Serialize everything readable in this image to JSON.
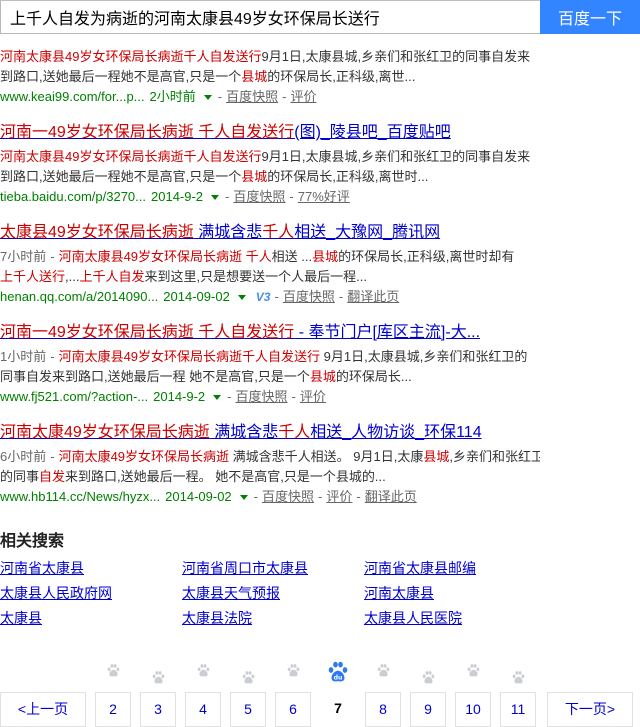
{
  "search": {
    "query": "上千人自发为病逝的河南太康县49岁女环保局长送行",
    "button_label": "百度一下"
  },
  "separator": "-",
  "results": [
    {
      "lines": [
        [
          {
            "text": "河南太康县49岁女环保局长病逝千人自发送行",
            "em": true
          },
          {
            "text": "9月1日,太康县城,乡亲们和张红卫的同事自发来",
            "em": false
          }
        ],
        [
          {
            "text": "到路口,送她最后一程她不是高官,只是一个",
            "em": false
          },
          {
            "text": "县城",
            "em": true
          },
          {
            "text": "的环保局长,正科级,离世...",
            "em": false
          }
        ]
      ],
      "url": "www.keai99.com/for...p...",
      "date": "2小时前",
      "links": [
        "百度快照",
        "评价"
      ]
    },
    {
      "title": [
        {
          "text": "河南一49岁女环保局长病逝 千人自发送行",
          "em": true
        },
        {
          "text": "(图)_陵县吧_百度贴吧",
          "em": false
        }
      ],
      "lines": [
        [
          {
            "text": "河南太康县49岁女环保局长病逝千人自发送行",
            "em": true
          },
          {
            "text": "9月1日,太康县城,乡亲们和张红卫的同事自发来",
            "em": false
          }
        ],
        [
          {
            "text": "到路口,送她最后一程她不是高官,只是一个",
            "em": false
          },
          {
            "text": "县城",
            "em": true
          },
          {
            "text": "的环保局长,正科级,离世时...",
            "em": false
          }
        ]
      ],
      "url": "tieba.baidu.com/p/3270...",
      "date": "2014-9-2",
      "links": [
        "百度快照",
        "77%好评"
      ]
    },
    {
      "title": [
        {
          "text": "太康县49岁女环保局长病逝",
          "em": true
        },
        {
          "text": " 满城含悲",
          "em": false
        },
        {
          "text": "千人",
          "em": true
        },
        {
          "text": "相送_大豫网_腾讯网",
          "em": false
        }
      ],
      "time": "7小时前",
      "lines": [
        [
          {
            "text": "河南太康县49岁女环保局长病逝 ",
            "em": true
          },
          {
            "text": "千人",
            "em": true
          },
          {
            "text": "相送 ...",
            "em": false
          },
          {
            "text": "县城",
            "em": true
          },
          {
            "text": "的环保局长,正科级,离世时却有",
            "em": false
          }
        ],
        [
          {
            "text": "上千人送行",
            "em": true
          },
          {
            "text": ",...",
            "em": false
          },
          {
            "text": "上千人自发",
            "em": true
          },
          {
            "text": "来到这里,只是想要送一个人最后一程...",
            "em": false
          }
        ]
      ],
      "url": "henan.qq.com/a/2014090...",
      "date": "2014-09-02",
      "badge": "V3",
      "links": [
        "百度快照",
        "翻译此页"
      ]
    },
    {
      "title": [
        {
          "text": "河南一49岁女环保局长病逝 千人自发送行",
          "em": true
        },
        {
          "text": " - 奉节门户[库区主流]-大...",
          "em": false
        }
      ],
      "time": "1小时前",
      "lines": [
        [
          {
            "text": "河南太康县49岁女环保局长病逝千人自发送行",
            "em": true
          },
          {
            "text": " 9月1日,太康县城,乡亲们和张红卫的",
            "em": false
          }
        ],
        [
          {
            "text": "同事自发来到路口,送她最后一程 她不是高官,只是一个",
            "em": false
          },
          {
            "text": "县城",
            "em": true
          },
          {
            "text": "的环保局长...",
            "em": false
          }
        ]
      ],
      "url": "www.fj521.com/?action-...",
      "date": "2014-9-2",
      "links": [
        "百度快照",
        "评价"
      ]
    },
    {
      "title": [
        {
          "text": "河南太康49岁女环保局长病逝",
          "em": true
        },
        {
          "text": " 满城含悲",
          "em": false
        },
        {
          "text": "千人",
          "em": true
        },
        {
          "text": "相送_人物访谈_环保114",
          "em": false
        }
      ],
      "time": "6小时前",
      "lines": [
        [
          {
            "text": "河南太康49岁女环保局长病逝",
            "em": true
          },
          {
            "text": " 满城含悲千人相送。 9月1日,太康",
            "em": false
          },
          {
            "text": "县城",
            "em": true
          },
          {
            "text": ",乡亲们和张红卫",
            "em": false
          }
        ],
        [
          {
            "text": "的同事",
            "em": false
          },
          {
            "text": "自发",
            "em": true
          },
          {
            "text": "来到路口,送她最后一程。 她不是高官,只是一个县城的...",
            "em": false
          }
        ]
      ],
      "url": "www.hb114.cc/News/hyzx...",
      "date": "2014-09-02",
      "links": [
        "百度快照",
        "评价",
        "翻译此页"
      ]
    }
  ],
  "related": {
    "heading": "相关搜索",
    "rows": [
      [
        "河南省太康县",
        "河南省周口市太康县",
        "河南省太康县邮编"
      ],
      [
        "太康县人民政府网",
        "太康县天气预报",
        "河南太康县"
      ],
      [
        "太康县",
        "太康县法院",
        "太康县人民医院"
      ]
    ]
  },
  "pagination": {
    "prev_label": "<上一页",
    "pages": [
      {
        "label": "2"
      },
      {
        "label": "3"
      },
      {
        "label": "4"
      },
      {
        "label": "5"
      },
      {
        "label": "6"
      },
      {
        "label": "7",
        "current": true
      },
      {
        "label": "8"
      },
      {
        "label": "9"
      },
      {
        "label": "10"
      },
      {
        "label": "11"
      }
    ],
    "next_label": "下一页>",
    "logo_text": "du"
  },
  "colors": {
    "link": "#0000cc",
    "keyword": "#cc0000",
    "url": "#008000",
    "muted": "#666666",
    "button": "#3385ff",
    "paw": "#c9cdd4",
    "logo": "#2d78f4"
  }
}
